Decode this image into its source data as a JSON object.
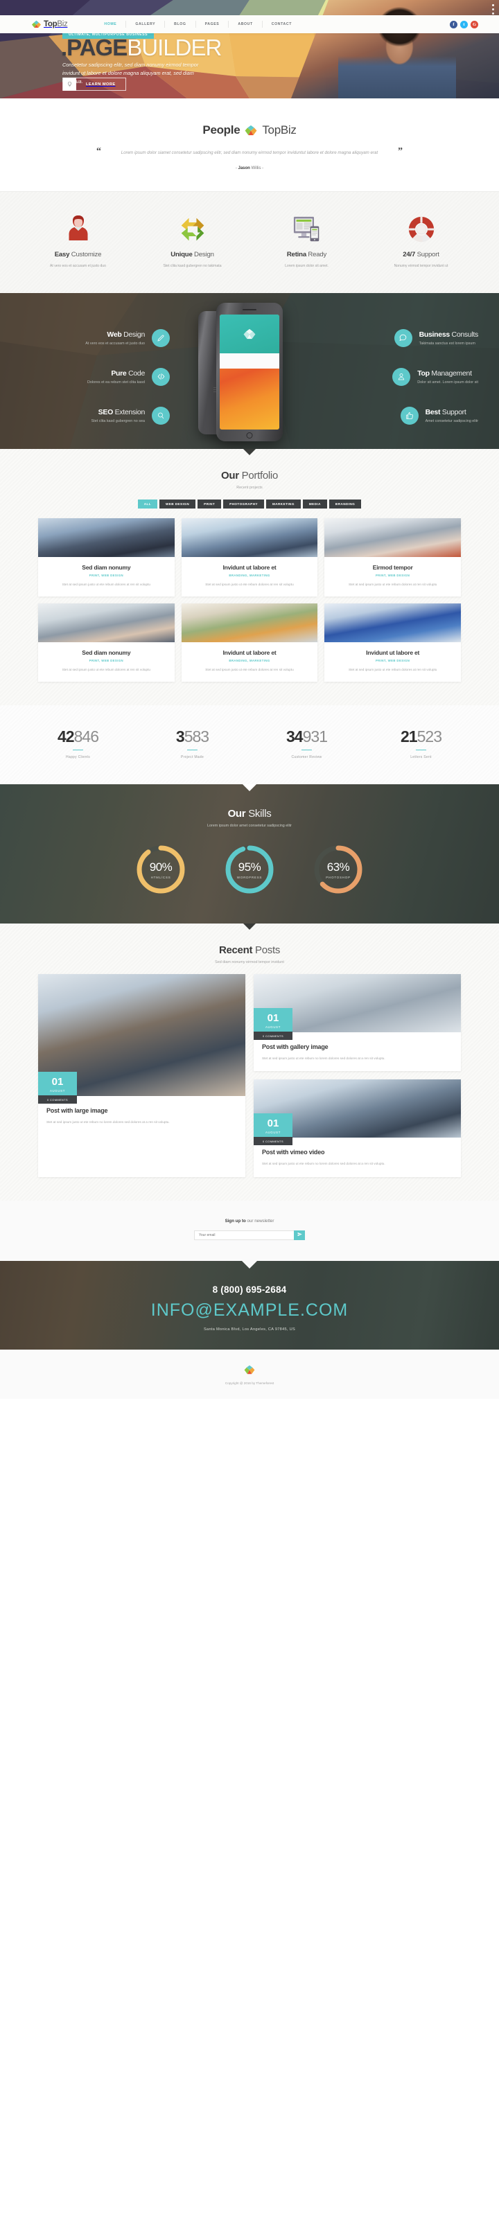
{
  "brand": {
    "name_bold": "Top",
    "name_light": "Biz",
    "logo_icon": "diamond-logo-icon"
  },
  "nav": {
    "items": [
      {
        "label": "HOME",
        "active": true
      },
      {
        "label": "GALLERY",
        "active": false
      },
      {
        "label": "BLOG",
        "active": false
      },
      {
        "label": "PAGES",
        "active": false
      },
      {
        "label": "ABOUT",
        "active": false
      },
      {
        "label": "CONTACT",
        "active": false
      }
    ],
    "social": [
      {
        "name": "facebook-icon",
        "glyph": "f",
        "color": "#3b5998"
      },
      {
        "name": "twitter-icon",
        "glyph": "t",
        "color": "#29b6f6"
      },
      {
        "name": "google-plus-icon",
        "glyph": "G",
        "color": "#dd4b39"
      }
    ]
  },
  "hero": {
    "badge": "ULTIMATE, MULTIPURPOSE BUSINESS",
    "title_bold": ".PAGE",
    "title_light": "BUILDER",
    "subtitle": "Consetetur sadipscing elitr, sed diam nonumy eirmod tempor invidunt ut labore et dolore magna aliquyam erat, sed diam voluptua.",
    "button_label": "LEARN MORE",
    "button_icon": "lightbulb-icon"
  },
  "quote": {
    "title_bold": "People",
    "title_light": "TopBiz",
    "text": "Lorem ipsum dolor siamet consetetur sadipscing elitr, sed diam nonumy eirmod tempor inviduntut labore et dolore magna aliquyam erat",
    "author_bold": "Jason",
    "author_light": "Willis",
    "author_prefix": "-",
    "author_suffix": "-"
  },
  "features": [
    {
      "icon": "user-avatar-icon",
      "title_bold": "Easy",
      "title_light": "Customize",
      "desc": "At vero eos et accusam et justo duo"
    },
    {
      "icon": "recycle-arrows-icon",
      "title_bold": "Unique",
      "title_light": "Design",
      "desc": "Stet clita kasd gubergren no takimata"
    },
    {
      "icon": "monitor-mobile-icon",
      "title_bold": "Retina",
      "title_light": "Ready",
      "desc": "Lorem ipsum dolor sit amet."
    },
    {
      "icon": "lifebuoy-icon",
      "title_bold": "24/7",
      "title_light": "Support",
      "desc": "Nonumy eirmod tempor invidunt ut"
    }
  ],
  "services": {
    "left": [
      {
        "icon": "pencil-icon",
        "title_bold": "Web",
        "title_light": "Design",
        "desc": "At vero eos et accusam et justo duo"
      },
      {
        "icon": "code-brackets-icon",
        "title_bold": "Pure",
        "title_light": "Code",
        "desc": "Dolores et ea rebum stet clita kasd"
      },
      {
        "icon": "magnifier-icon",
        "title_bold": "SEO",
        "title_light": "Extension",
        "desc": "Stet clita kasd gubergren no sea"
      }
    ],
    "right": [
      {
        "icon": "speech-bubble-icon",
        "title_bold": "Business",
        "title_light": "Consults",
        "desc": "Takimata sanctus est lorem ipsum"
      },
      {
        "icon": "user-tie-icon",
        "title_bold": "Top",
        "title_light": "Management",
        "desc": "Dolor sit amet. Lorem ipsum dolor sit"
      },
      {
        "icon": "thumbs-up-icon",
        "title_bold": "Best",
        "title_light": "Support",
        "desc": "Amet consetetur sadipscing elitr"
      }
    ],
    "phone_label": "iPhone"
  },
  "portfolio": {
    "title_bold": "Our",
    "title_light": "Portfolio",
    "subtitle": "Recent projects",
    "filters": [
      {
        "label": "ALL",
        "active": true
      },
      {
        "label": "WEB DESIGN",
        "active": false
      },
      {
        "label": "PRINT",
        "active": false
      },
      {
        "label": "PHOTOGRAPHY",
        "active": false
      },
      {
        "label": "MARKETING",
        "active": false
      },
      {
        "label": "MEDIA",
        "active": false
      },
      {
        "label": "BRANDING",
        "active": false
      }
    ],
    "items": [
      {
        "title": "Sed diam nonumy",
        "cats": "PRINT, WEB DESIGN",
        "desc": "Stet at sed ipsum justo ut ete rebum dolores at ren sit voluptu",
        "img": "im1"
      },
      {
        "title": "Invidunt ut labore et",
        "cats": "BRANDING, MARKETING",
        "desc": "Stet at sed ipsum justo ut ete rebum dolores at ren sit voluptu",
        "img": "im2"
      },
      {
        "title": "Eirmod tempor",
        "cats": "PRINT, WEB DESIGN",
        "desc": "Stet at sed ipsum justo ut ete rebum dolores at ren sit voluptu",
        "img": "im3"
      },
      {
        "title": "Sed diam nonumy",
        "cats": "PRINT, WEB DESIGN",
        "desc": "Stet at sed ipsum justo ut ete rebum dolores at ren sit voluptu",
        "img": "im4"
      },
      {
        "title": "Invidunt ut labore et",
        "cats": "BRANDING, MARKETING",
        "desc": "Stet at sed ipsum justo ut ete rebum dolores at ren sit voluptu",
        "img": "im5"
      },
      {
        "title": "Invidunt ut labore et",
        "cats": "PRINT, WEB DESIGN",
        "desc": "Stet at sed ipsum justo ut ete rebum dolores at ren sit voluptu",
        "img": "im6"
      }
    ]
  },
  "counters": [
    {
      "bold": "42",
      "light": "846",
      "label": "Happy Clients"
    },
    {
      "bold": "3",
      "light": "583",
      "label": "Project Made"
    },
    {
      "bold": "34",
      "light": "931",
      "label": "Customer Review"
    },
    {
      "bold": "21",
      "light": "523",
      "label": "Letters Sent"
    }
  ],
  "skills": {
    "title_bold": "Our",
    "title_light": "Skills",
    "subtitle": "Lorem ipsum dolor amet consetetur sadipscing elitr",
    "items": [
      {
        "pct": 90,
        "pct_label": "90%",
        "name": "HTML/CSS",
        "color": "#f0c06a",
        "track": "#4a4f48"
      },
      {
        "pct": 95,
        "pct_label": "95%",
        "name": "WORDPRESS",
        "color": "#5ec9ca",
        "track": "#4a4f48"
      },
      {
        "pct": 63,
        "pct_label": "63%",
        "name": "PHOTOSHOP",
        "color": "#e8a06a",
        "track": "#4a4f48"
      }
    ]
  },
  "blog": {
    "title_bold": "Recent",
    "title_light": "Posts",
    "subtitle": "Sed diam nonumy eirmod tempor invidunt",
    "posts": [
      {
        "day": "01",
        "month": "AUGUST",
        "comments": "0 COMMENTS",
        "title": "Post with large image",
        "desc": "Stet at sed ipsum justo ut ete rebum no lorem dolores sed dolores at a ren sit voluptu.",
        "img": "bi1",
        "tall": true
      },
      {
        "day": "01",
        "month": "AUGUST",
        "comments": "0 COMMENTS",
        "title": "Post with gallery image",
        "desc": "Stet at sed ipsum justo ut ete rebum no lorem dolores sed dolores at a ren sit voluptu.",
        "img": "bi2",
        "tall": false
      },
      {
        "day": "01",
        "month": "AUGUST",
        "comments": "0 COMMENTS",
        "title": "Post with vimeo video",
        "desc": "Stet at sed ipsum justo ut ete rebum no lorem dolores sed dolores at a ren sit voluptu.",
        "img": "bi4",
        "tall": false
      }
    ]
  },
  "newsletter": {
    "title_bold": "Sign up to",
    "title_light": "our newsletter",
    "placeholder": "Your email",
    "value": "",
    "button_icon": "paper-plane-icon"
  },
  "footer": {
    "phone": "8 (800) 695-2684",
    "email": "INFO@EXAMPLE.COM",
    "address": "Santa Monica Blvd, Los Angeles, CA 97845, US",
    "copyright": "Copyright @ 2016 by Themeforest",
    "logo_icon": "diamond-logo-icon"
  },
  "colors": {
    "accent_teal": "#5ec9ca",
    "dark": "#3c3f41",
    "facebook": "#3b5998",
    "twitter": "#29b6f6",
    "google": "#dd4b39"
  }
}
